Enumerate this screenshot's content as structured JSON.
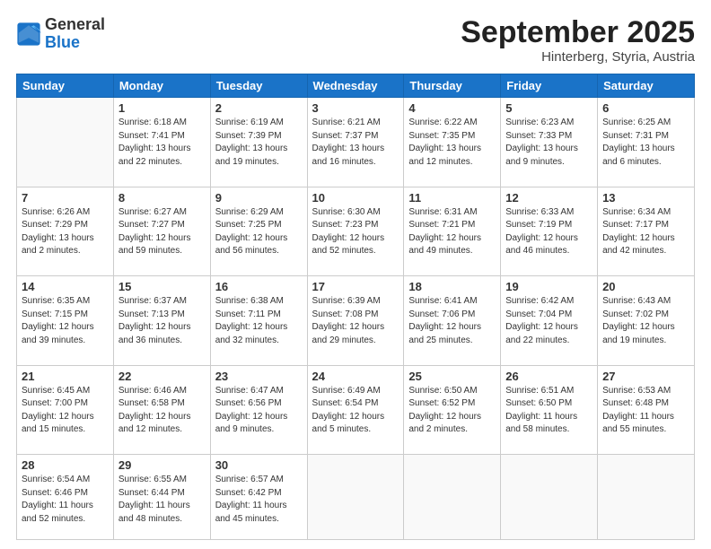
{
  "header": {
    "logo_general": "General",
    "logo_blue": "Blue",
    "month_title": "September 2025",
    "location": "Hinterberg, Styria, Austria"
  },
  "weekdays": [
    "Sunday",
    "Monday",
    "Tuesday",
    "Wednesday",
    "Thursday",
    "Friday",
    "Saturday"
  ],
  "weeks": [
    [
      {
        "day": "",
        "info": ""
      },
      {
        "day": "1",
        "info": "Sunrise: 6:18 AM\nSunset: 7:41 PM\nDaylight: 13 hours\nand 22 minutes."
      },
      {
        "day": "2",
        "info": "Sunrise: 6:19 AM\nSunset: 7:39 PM\nDaylight: 13 hours\nand 19 minutes."
      },
      {
        "day": "3",
        "info": "Sunrise: 6:21 AM\nSunset: 7:37 PM\nDaylight: 13 hours\nand 16 minutes."
      },
      {
        "day": "4",
        "info": "Sunrise: 6:22 AM\nSunset: 7:35 PM\nDaylight: 13 hours\nand 12 minutes."
      },
      {
        "day": "5",
        "info": "Sunrise: 6:23 AM\nSunset: 7:33 PM\nDaylight: 13 hours\nand 9 minutes."
      },
      {
        "day": "6",
        "info": "Sunrise: 6:25 AM\nSunset: 7:31 PM\nDaylight: 13 hours\nand 6 minutes."
      }
    ],
    [
      {
        "day": "7",
        "info": "Sunrise: 6:26 AM\nSunset: 7:29 PM\nDaylight: 13 hours\nand 2 minutes."
      },
      {
        "day": "8",
        "info": "Sunrise: 6:27 AM\nSunset: 7:27 PM\nDaylight: 12 hours\nand 59 minutes."
      },
      {
        "day": "9",
        "info": "Sunrise: 6:29 AM\nSunset: 7:25 PM\nDaylight: 12 hours\nand 56 minutes."
      },
      {
        "day": "10",
        "info": "Sunrise: 6:30 AM\nSunset: 7:23 PM\nDaylight: 12 hours\nand 52 minutes."
      },
      {
        "day": "11",
        "info": "Sunrise: 6:31 AM\nSunset: 7:21 PM\nDaylight: 12 hours\nand 49 minutes."
      },
      {
        "day": "12",
        "info": "Sunrise: 6:33 AM\nSunset: 7:19 PM\nDaylight: 12 hours\nand 46 minutes."
      },
      {
        "day": "13",
        "info": "Sunrise: 6:34 AM\nSunset: 7:17 PM\nDaylight: 12 hours\nand 42 minutes."
      }
    ],
    [
      {
        "day": "14",
        "info": "Sunrise: 6:35 AM\nSunset: 7:15 PM\nDaylight: 12 hours\nand 39 minutes."
      },
      {
        "day": "15",
        "info": "Sunrise: 6:37 AM\nSunset: 7:13 PM\nDaylight: 12 hours\nand 36 minutes."
      },
      {
        "day": "16",
        "info": "Sunrise: 6:38 AM\nSunset: 7:11 PM\nDaylight: 12 hours\nand 32 minutes."
      },
      {
        "day": "17",
        "info": "Sunrise: 6:39 AM\nSunset: 7:08 PM\nDaylight: 12 hours\nand 29 minutes."
      },
      {
        "day": "18",
        "info": "Sunrise: 6:41 AM\nSunset: 7:06 PM\nDaylight: 12 hours\nand 25 minutes."
      },
      {
        "day": "19",
        "info": "Sunrise: 6:42 AM\nSunset: 7:04 PM\nDaylight: 12 hours\nand 22 minutes."
      },
      {
        "day": "20",
        "info": "Sunrise: 6:43 AM\nSunset: 7:02 PM\nDaylight: 12 hours\nand 19 minutes."
      }
    ],
    [
      {
        "day": "21",
        "info": "Sunrise: 6:45 AM\nSunset: 7:00 PM\nDaylight: 12 hours\nand 15 minutes."
      },
      {
        "day": "22",
        "info": "Sunrise: 6:46 AM\nSunset: 6:58 PM\nDaylight: 12 hours\nand 12 minutes."
      },
      {
        "day": "23",
        "info": "Sunrise: 6:47 AM\nSunset: 6:56 PM\nDaylight: 12 hours\nand 9 minutes."
      },
      {
        "day": "24",
        "info": "Sunrise: 6:49 AM\nSunset: 6:54 PM\nDaylight: 12 hours\nand 5 minutes."
      },
      {
        "day": "25",
        "info": "Sunrise: 6:50 AM\nSunset: 6:52 PM\nDaylight: 12 hours\nand 2 minutes."
      },
      {
        "day": "26",
        "info": "Sunrise: 6:51 AM\nSunset: 6:50 PM\nDaylight: 11 hours\nand 58 minutes."
      },
      {
        "day": "27",
        "info": "Sunrise: 6:53 AM\nSunset: 6:48 PM\nDaylight: 11 hours\nand 55 minutes."
      }
    ],
    [
      {
        "day": "28",
        "info": "Sunrise: 6:54 AM\nSunset: 6:46 PM\nDaylight: 11 hours\nand 52 minutes."
      },
      {
        "day": "29",
        "info": "Sunrise: 6:55 AM\nSunset: 6:44 PM\nDaylight: 11 hours\nand 48 minutes."
      },
      {
        "day": "30",
        "info": "Sunrise: 6:57 AM\nSunset: 6:42 PM\nDaylight: 11 hours\nand 45 minutes."
      },
      {
        "day": "",
        "info": ""
      },
      {
        "day": "",
        "info": ""
      },
      {
        "day": "",
        "info": ""
      },
      {
        "day": "",
        "info": ""
      }
    ]
  ]
}
